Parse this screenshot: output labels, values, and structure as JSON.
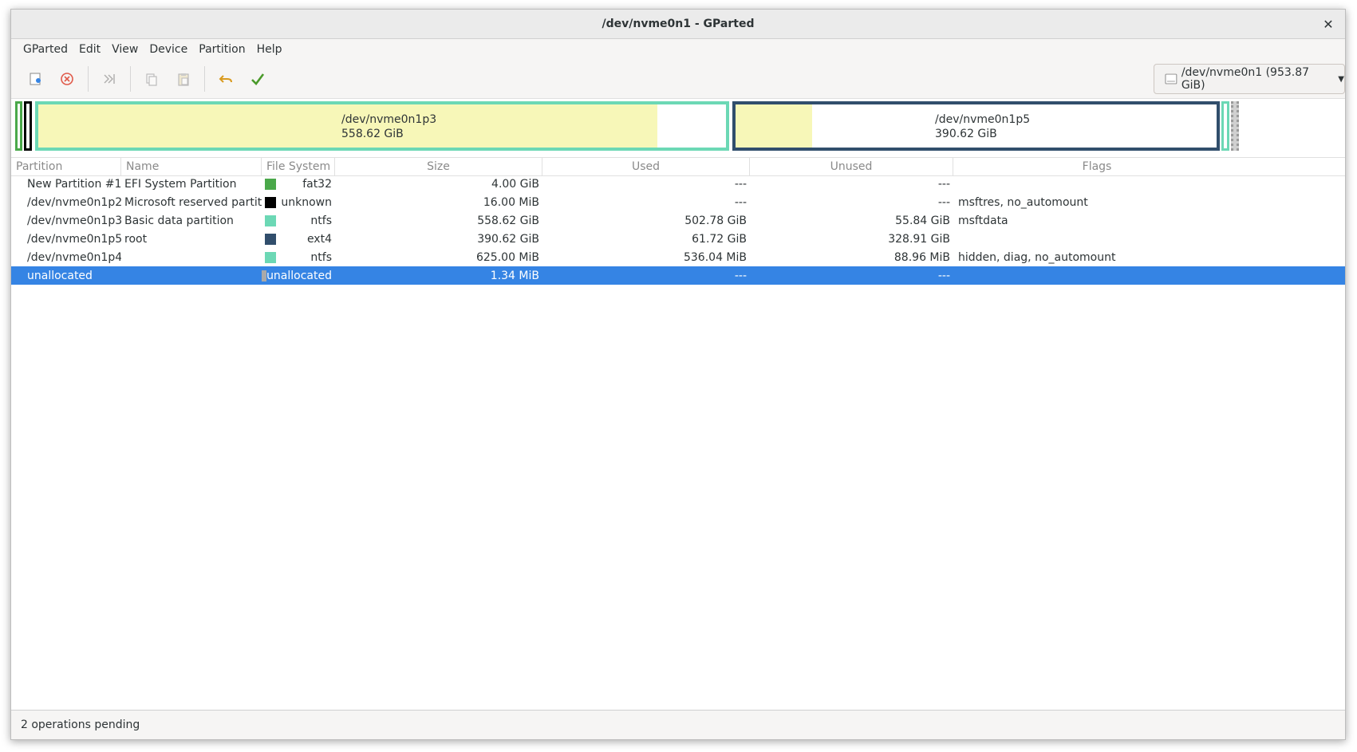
{
  "window": {
    "title": "/dev/nvme0n1 - GParted"
  },
  "menu": [
    "GParted",
    "Edit",
    "View",
    "Device",
    "Partition",
    "Help"
  ],
  "toolbar": {
    "icons": [
      "new-partition-icon",
      "delete-icon",
      "resize-move-icon",
      "copy-icon",
      "paste-icon",
      "undo-icon",
      "apply-icon"
    ],
    "device_selector": "/dev/nvme0n1 (953.87 GiB)"
  },
  "disk_map": {
    "p3": {
      "name": "/dev/nvme0n1p3",
      "size": "558.62 GiB",
      "used_fraction": 0.9
    },
    "p5": {
      "name": "/dev/nvme0n1p5",
      "size": "390.62 GiB",
      "used_fraction": 0.16
    }
  },
  "columns": [
    "Partition",
    "Name",
    "File System",
    "Size",
    "Used",
    "Unused",
    "Flags"
  ],
  "rows": [
    {
      "partition": "New Partition #1",
      "name": "EFI System Partition",
      "fs": "fat32",
      "color": "#4aa84a",
      "size": "4.00 GiB",
      "used": "---",
      "unused": "---",
      "flags": ""
    },
    {
      "partition": "/dev/nvme0n1p2",
      "name": "Microsoft reserved partition",
      "fs": "unknown",
      "color": "#000000",
      "size": "16.00 MiB",
      "used": "---",
      "unused": "---",
      "flags": "msftres, no_automount",
      "warning": true
    },
    {
      "partition": "/dev/nvme0n1p3",
      "name": "Basic data partition",
      "fs": "ntfs",
      "color": "#6cd8b5",
      "size": "558.62 GiB",
      "used": "502.78 GiB",
      "unused": "55.84 GiB",
      "flags": "msftdata"
    },
    {
      "partition": "/dev/nvme0n1p5",
      "name": "root",
      "fs": "ext4",
      "color": "#314e6c",
      "size": "390.62 GiB",
      "used": "61.72 GiB",
      "unused": "328.91 GiB",
      "flags": ""
    },
    {
      "partition": "/dev/nvme0n1p4",
      "name": "",
      "fs": "ntfs",
      "color": "#6cd8b5",
      "size": "625.00 MiB",
      "used": "536.04 MiB",
      "unused": "88.96 MiB",
      "flags": "hidden, diag, no_automount"
    },
    {
      "partition": "unallocated",
      "name": "",
      "fs": "unallocated",
      "color": "#a9a9a9",
      "size": "1.34 MiB",
      "used": "---",
      "unused": "---",
      "flags": "",
      "selected": true
    }
  ],
  "status": "2 operations pending"
}
